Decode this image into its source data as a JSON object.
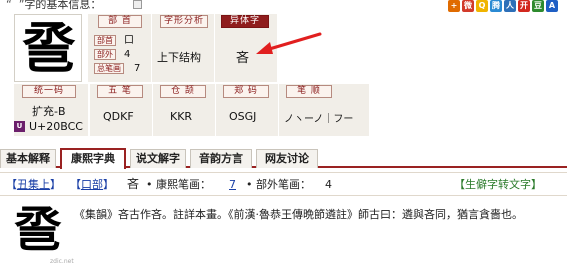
{
  "header": {
    "title_prefix": "“",
    "title_quote_close": "”",
    "title_suffix": "字的基本信息：",
    "social_icons": [
      {
        "name": "share-icon",
        "glyph": "+",
        "color": "#e06b00"
      },
      {
        "name": "weibo-icon",
        "glyph": "微",
        "color": "#d23b2b"
      },
      {
        "name": "qzone-icon",
        "glyph": "Q",
        "color": "#f0b400"
      },
      {
        "name": "tqq-icon",
        "glyph": "腾",
        "color": "#2a8ad3"
      },
      {
        "name": "renren-icon",
        "glyph": "人",
        "color": "#2d6fb8"
      },
      {
        "name": "kaixin-icon",
        "glyph": "开",
        "color": "#d2281e"
      },
      {
        "name": "douban-icon",
        "glyph": "豆",
        "color": "#2e8b2e"
      },
      {
        "name": "baidu-icon",
        "glyph": "A",
        "color": "#1f5fc4"
      }
    ]
  },
  "character": "巹",
  "basic_info": {
    "radical": {
      "header": "部 首",
      "radical_tag": "部首",
      "radical_value": "口",
      "outside_tag": "部外",
      "outside_value": "4",
      "total_tag": "总笔画",
      "total_value": "7"
    },
    "structure": {
      "header": "字形分析",
      "value": "上下结构"
    },
    "variant": {
      "header": "异体字",
      "value": "吝"
    },
    "unicode": {
      "header": "统一码",
      "extension": "扩充-B",
      "codepoint": "U+20BCC",
      "icon": "unicode-icon"
    },
    "wubi": {
      "header": "五 笔",
      "value": "QDKF"
    },
    "cangjie": {
      "header": "仓 颉",
      "value": "KKR"
    },
    "zhengma": {
      "header": "郑 码",
      "value": "OSGJ"
    },
    "bishun": {
      "header": "笔 顺",
      "value": "ノヽーノ｜フー"
    }
  },
  "tabs": [
    {
      "label": "基本解释",
      "active": false
    },
    {
      "label": "康熙字典",
      "active": true
    },
    {
      "label": "说文解字",
      "active": false
    },
    {
      "label": "音韵方言",
      "active": false
    },
    {
      "label": "网友讨论",
      "active": false
    }
  ],
  "kangxi": {
    "bracket_open": "【",
    "bracket_close": "】",
    "chou_label": "丑集上",
    "radical_label": "口部",
    "char": "吝",
    "stroke_label": "• 康熙笔画：",
    "stroke_value": "7",
    "outside_label": "• 部外笔画：",
    "outside_value": "4",
    "convert_label": "【生僻字转文字】",
    "watermark": "zdic.net",
    "text": "《集韻》吝古作吝。註詳本畫。《前漢·魯恭王傳晩節遴註》師古曰：遴與吝同，猶言貪嗇也。"
  }
}
